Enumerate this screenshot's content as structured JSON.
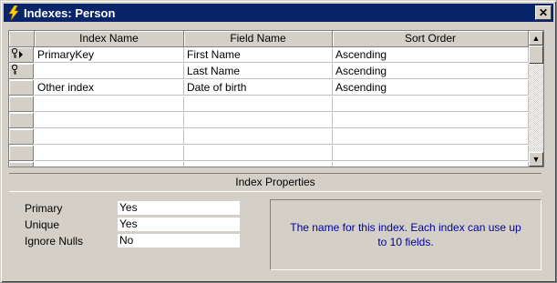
{
  "window": {
    "title": "Indexes: Person",
    "close_glyph": "✕"
  },
  "grid": {
    "columns": [
      "Index Name",
      "Field Name",
      "Sort Order"
    ],
    "rows": [
      {
        "selector": "key-current",
        "index_name": "PrimaryKey",
        "field_name": "First Name",
        "sort_order": "Ascending"
      },
      {
        "selector": "key",
        "index_name": "",
        "field_name": "Last Name",
        "sort_order": "Ascending"
      },
      {
        "selector": "",
        "index_name": "Other index",
        "field_name": "Date of birth",
        "sort_order": "Ascending"
      },
      {
        "selector": "",
        "index_name": "",
        "field_name": "",
        "sort_order": ""
      },
      {
        "selector": "",
        "index_name": "",
        "field_name": "",
        "sort_order": ""
      },
      {
        "selector": "",
        "index_name": "",
        "field_name": "",
        "sort_order": ""
      },
      {
        "selector": "",
        "index_name": "",
        "field_name": "",
        "sort_order": ""
      },
      {
        "selector": "",
        "index_name": "",
        "field_name": "",
        "sort_order": ""
      }
    ]
  },
  "properties": {
    "header": "Index Properties",
    "fields": [
      {
        "label": "Primary",
        "value": "Yes"
      },
      {
        "label": "Unique",
        "value": "Yes"
      },
      {
        "label": "Ignore Nulls",
        "value": "No"
      }
    ],
    "help_text": "The name for this index.  Each index can use up to 10 fields."
  },
  "colors": {
    "titlebar": "#0a246a",
    "face": "#d4d0c8",
    "help_text": "#0000a0"
  },
  "icons": {
    "title": "lightning-icon",
    "primary_key": "key-icon",
    "current_row": "row-pointer-icon"
  }
}
